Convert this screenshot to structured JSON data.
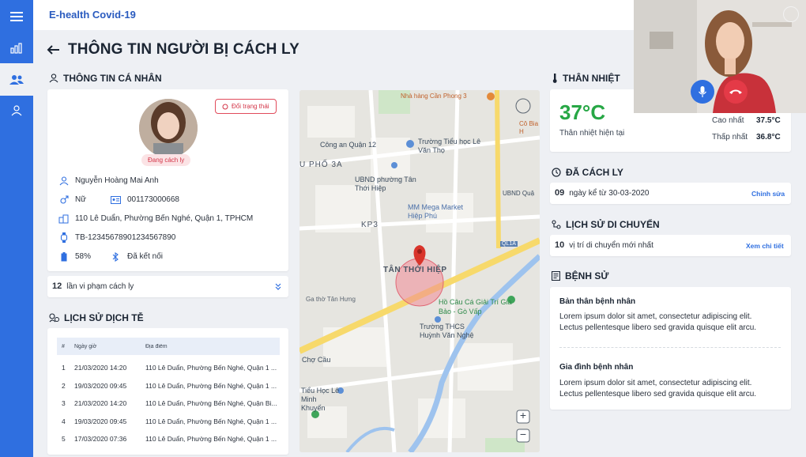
{
  "app": {
    "title": "E-health Covid-19"
  },
  "page": {
    "title": "THÔNG TIN NGƯỜI BỊ CÁCH LY"
  },
  "personal": {
    "section_title": "THÔNG TIN CÁ NHÂN",
    "status": "Đang cách ly",
    "switch_label": "Đổi trạng thái",
    "name": "Nguyễn Hoàng Mai Anh",
    "gender": "Nữ",
    "id_number": "001173000668",
    "address": "110 Lê Duẩn, Phường Bến Nghé, Quận 1, TPHCM",
    "device_id": "TB-12345678901234567890",
    "battery": "58%",
    "connection": "Đã kết nối",
    "violations_count": "12",
    "violations_label": "lần vi phạm cách ly"
  },
  "history": {
    "section_title": "LỊCH SỬ DỊCH TỄ",
    "columns": [
      "#",
      "Ngày giờ",
      "Địa điểm"
    ],
    "rows": [
      {
        "n": "1",
        "time": "21/03/2020   14:20",
        "place": "110 Lê Duẩn, Phường Bến Nghé, Quận 1 ..."
      },
      {
        "n": "2",
        "time": "19/03/2020   09:45",
        "place": "110 Lê Duẩn, Phường Bến Nghé, Quận 1 ..."
      },
      {
        "n": "3",
        "time": "21/03/2020   14:20",
        "place": "110 Lê Duẩn, Phường Bến Nghé, Quận Bi..."
      },
      {
        "n": "4",
        "time": "19/03/2020   09:45",
        "place": "110 Lê Duẩn, Phường Bến Nghé, Quận 1 ..."
      },
      {
        "n": "5",
        "time": "17/03/2020   07:36",
        "place": "110 Lê Duẩn, Phường Bến Nghé, Quận 1 ..."
      }
    ]
  },
  "map": {
    "labels": {
      "l1": "Nhà hàng Cần Phong 3",
      "l2": "Công an Quận 12",
      "l3": "Trường Tiểu học Lê Văn Thọ",
      "l4": "U PHỐ 3A",
      "l5": "UBND phường Tân Thới Hiệp",
      "l6": "MM Mega Market Hiệp Phú",
      "l7": "KP3",
      "l8": "TÂN THỚI HIỆP",
      "l9": "Hồ Câu Cá Giải Trí Gia Bảo - Gò Vấp",
      "l10": "Trường THCS Huỳnh Văn Nghệ",
      "l11": "Chợ Cầu",
      "l12": "Tiểu Học Lê Minh Khuyến",
      "l13": "Ga thờ Tân Hưng",
      "l14": "QL1A",
      "l15": "UBND Quậ",
      "l16": "Cô Bia H"
    },
    "zoom_in": "+",
    "zoom_out": "−"
  },
  "temperature": {
    "section_title": "THÂN NHIỆT",
    "value": "37°C",
    "label": "Thân nhiệt hiện tại",
    "high_label": "Cao nhất",
    "high_value": "37.5°C",
    "low_label": "Thấp nhất",
    "low_value": "36.8°C"
  },
  "quarantine": {
    "section_title": "ĐÃ CÁCH LY",
    "days": "09",
    "text": "ngày kể từ 30-03-2020",
    "edit_label": "Chỉnh sửa"
  },
  "travel": {
    "section_title": "LỊCH SỬ DI CHUYỂN",
    "count": "10",
    "text": "vị trí di chuyển mới nhất",
    "detail_label": "Xem chi tiết"
  },
  "medical": {
    "section_title": "BỆNH SỬ",
    "patient_title": "Bản thân bệnh nhân",
    "patient_text1": "Lorem ipsum dolor sit amet, consectetur adipiscing elit.",
    "patient_text2": "Lectus pellentesque libero sed gravida quisque elit arcu.",
    "family_title": "Gia đình bệnh nhân",
    "family_text1": "Lorem ipsum dolor sit amet, consectetur adipiscing elit.",
    "family_text2": "Lectus pellentesque libero sed gravida quisque elit arcu."
  },
  "colors": {
    "primary": "#2f6fe0",
    "danger": "#e14b5b",
    "success": "#27a745"
  }
}
